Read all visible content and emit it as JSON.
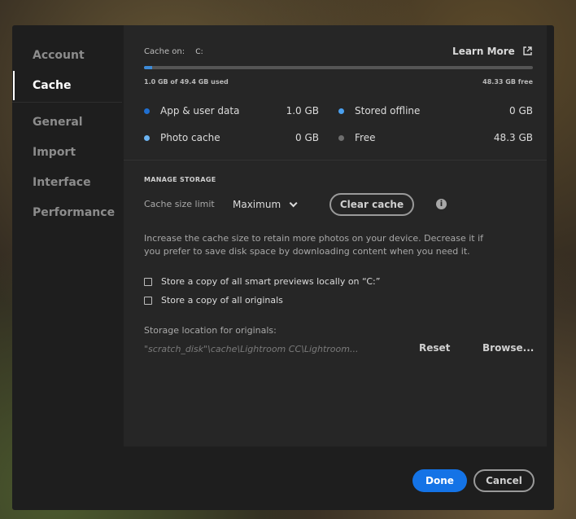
{
  "sidebar": {
    "items": [
      {
        "label": "Account"
      },
      {
        "label": "Cache"
      },
      {
        "label": "General"
      },
      {
        "label": "Import"
      },
      {
        "label": "Interface"
      },
      {
        "label": "Performance"
      }
    ],
    "active": "Cache"
  },
  "cache": {
    "cache_on_label": "Cache on:",
    "drive": "C:",
    "learn_more": "Learn More",
    "usage_fraction": 0.02,
    "used_text": "1.0 GB of 49.4 GB used",
    "free_text": "48.33 GB free",
    "stats": [
      {
        "label": "App & user data",
        "value": "1.0 GB",
        "color": "#1f6fd1"
      },
      {
        "label": "Stored offline",
        "value": "0 GB",
        "color": "#4aa0ef"
      },
      {
        "label": "Photo cache",
        "value": "0 GB",
        "color": "#6cb4f2"
      },
      {
        "label": "Free",
        "value": "48.3 GB",
        "color": "#6e6e6e"
      }
    ]
  },
  "manage": {
    "heading": "MANAGE STORAGE",
    "limit_label": "Cache size limit",
    "limit_value": "Maximum",
    "clear_label": "Clear cache",
    "description": "Increase the cache size to retain more photos on your device. Decrease it if you prefer to save disk space by downloading content when you need it.",
    "checkbox_smart": "Store a copy of all smart previews locally on “C:”",
    "checkbox_originals": "Store a copy of all originals",
    "location_label": "Storage location for originals:",
    "location_path": "\"scratch_disk\"\\cache\\Lightroom CC\\Lightroom...",
    "reset_label": "Reset",
    "browse_label": "Browse..."
  },
  "footer": {
    "done_label": "Done",
    "cancel_label": "Cancel"
  }
}
